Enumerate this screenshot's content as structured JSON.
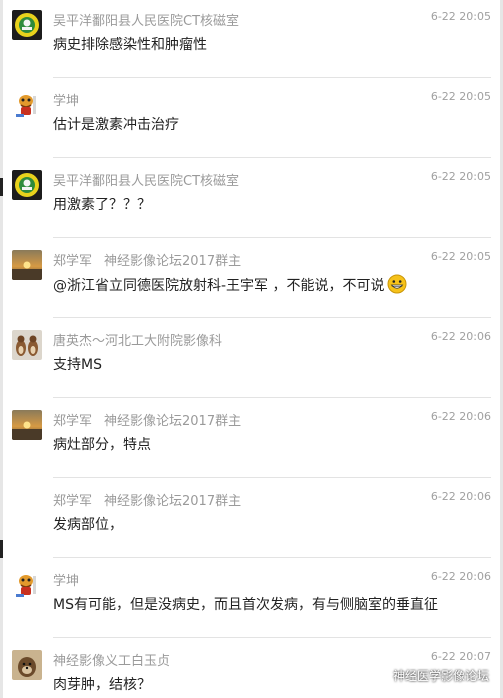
{
  "messages": [
    {
      "avatar": "hospital-logo-avatar",
      "sender": "吴平洋鄱阳县人民医院CT核磁室",
      "role": "",
      "time": "6-22 20:05",
      "text": "病史排除感染性和肿瘤性"
    },
    {
      "avatar": "cartoon-character-avatar",
      "sender": "学坤",
      "role": "",
      "time": "6-22 20:05",
      "text": "估计是激素冲击治疗"
    },
    {
      "avatar": "hospital-logo-avatar",
      "sender": "吴平洋鄱阳县人民医院CT核磁室",
      "role": "",
      "time": "6-22 20:05",
      "text": "用激素了？？？"
    },
    {
      "avatar": "sunset-photo-avatar",
      "sender": "郑学军",
      "role": "神经影像论坛2017群主",
      "time": "6-22 20:05",
      "text": "@浙江省立同德医院放射科-王宇军 ，不能说，不可说",
      "emoji": "grinning-emoji"
    },
    {
      "avatar": "squirrels-photo-avatar",
      "sender": "唐英杰～河北工大附院影像科",
      "role": "",
      "time": "6-22 20:06",
      "text": "支持MS"
    },
    {
      "avatar": "sunset-photo-avatar",
      "sender": "郑学军",
      "role": "神经影像论坛2017群主",
      "time": "6-22 20:06",
      "text": "病灶部分，特点"
    },
    {
      "avatar": "none",
      "sender": "郑学军",
      "role": "神经影像论坛2017群主",
      "time": "6-22 20:06",
      "text": "发病部位，"
    },
    {
      "avatar": "cartoon-character-avatar",
      "sender": "学坤",
      "role": "",
      "time": "6-22 20:06",
      "text": "MS有可能，但是没病史，而且首次发病，有与侧脑室的垂直征"
    },
    {
      "avatar": "dog-photo-avatar",
      "sender": "神经影像义工白玉贞",
      "role": "",
      "time": "6-22 20:07",
      "text": "肉芽肿，结核？"
    }
  ],
  "watermark": {
    "icon": "wechat-channel-icon",
    "text": "神经医学影像论坛"
  }
}
